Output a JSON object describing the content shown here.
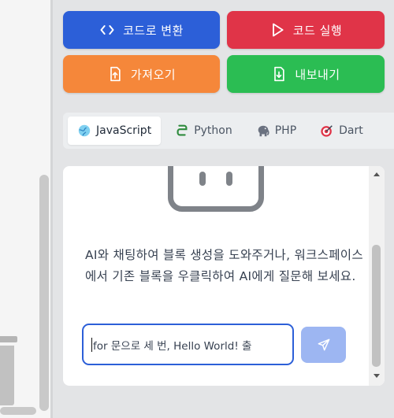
{
  "toolbar": {
    "convert_label": "코드로 변환",
    "run_label": "코드 실행",
    "import_label": "가져오기",
    "export_label": "내보내기"
  },
  "tabs": [
    {
      "label": "JavaScript",
      "icon": "globe-icon",
      "active": true
    },
    {
      "label": "Python",
      "icon": "python-icon",
      "active": false
    },
    {
      "label": "PHP",
      "icon": "elephant-icon",
      "active": false
    },
    {
      "label": "Dart",
      "icon": "dart-icon",
      "active": false
    }
  ],
  "chat": {
    "message": "AI와 채팅하여 블록 생성을 도와주거나, 워크스페이스에서 기존 블록을 우클릭하여 AI에게 질문해 보세요.",
    "input_value": "for 문으로 세 번, Hello World! 출"
  },
  "colors": {
    "convert": "#2c5fd8",
    "run": "#e03448",
    "import": "#f5873a",
    "export": "#2bbd53",
    "send_disabled": "#9db6f2"
  }
}
